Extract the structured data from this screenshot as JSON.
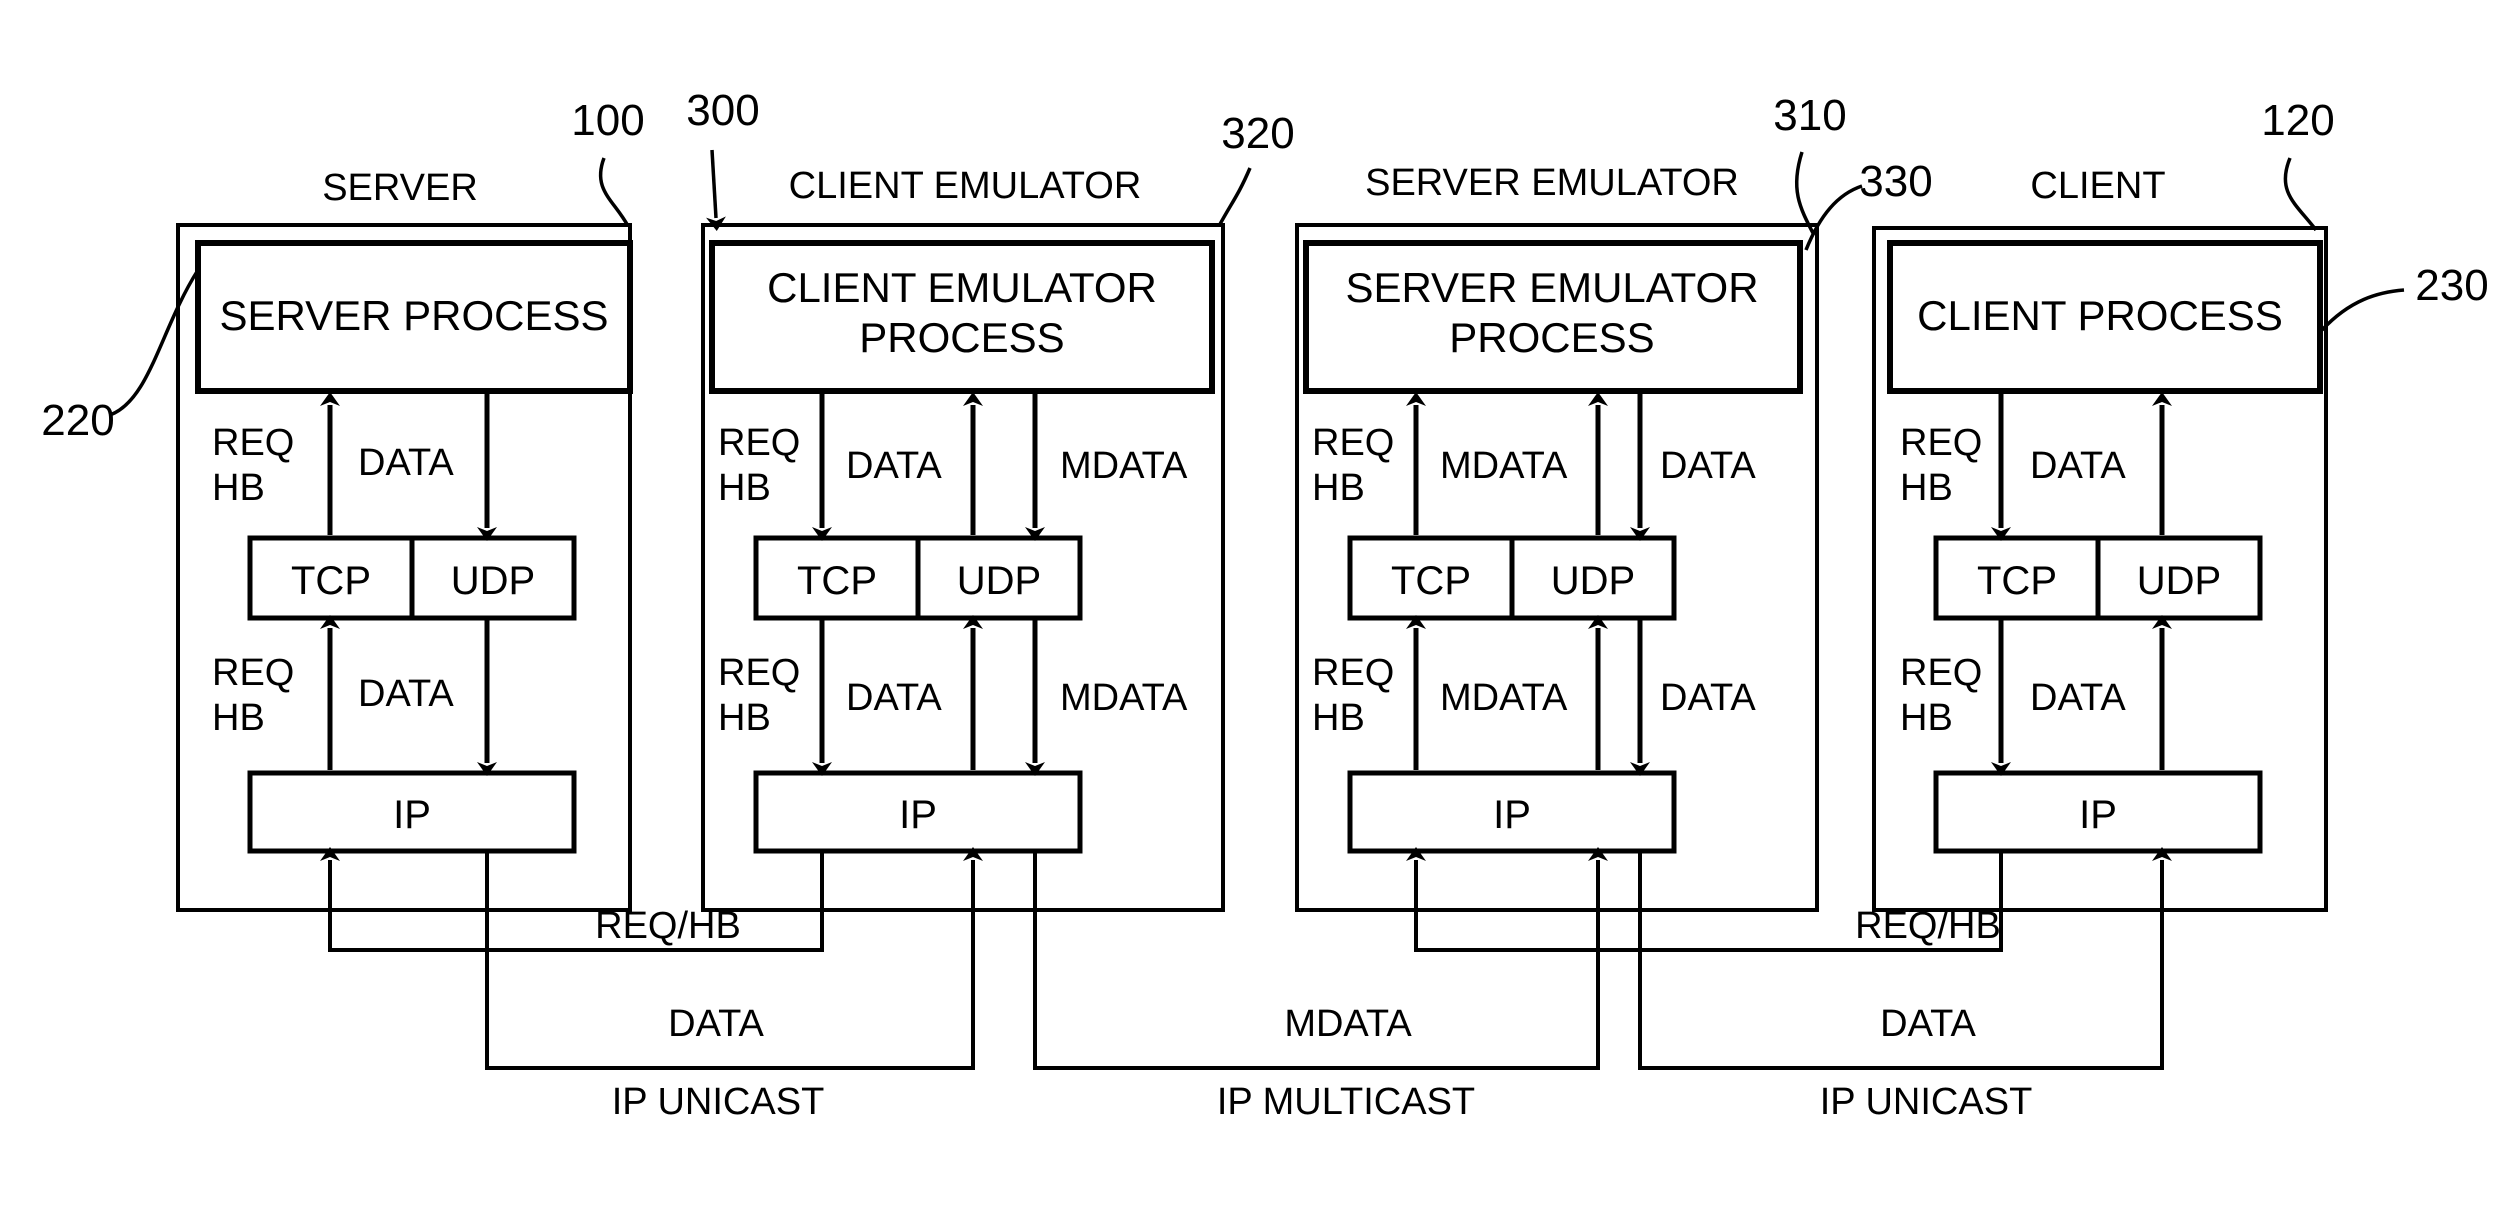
{
  "figure": {
    "title": "Client/Server emulator network stack block diagram",
    "line_color": "#000000",
    "background": "#ffffff"
  },
  "reference_numerals": [
    {
      "id": "ref-100",
      "value": "100",
      "points_to": "server-outer-box"
    },
    {
      "id": "ref-220",
      "value": "220",
      "points_to": "server-process-box"
    },
    {
      "id": "ref-300",
      "value": "300",
      "points_to": "client-emulator-outer-box"
    },
    {
      "id": "ref-320",
      "value": "320",
      "points_to": "client-emulator-process-box"
    },
    {
      "id": "ref-310",
      "value": "310",
      "points_to": "server-emulator-outer-box"
    },
    {
      "id": "ref-330",
      "value": "330",
      "points_to": "server-emulator-process-box"
    },
    {
      "id": "ref-120",
      "value": "120",
      "points_to": "client-outer-box"
    },
    {
      "id": "ref-230",
      "value": "230",
      "points_to": "client-process-box"
    }
  ],
  "panels": [
    {
      "key": "server",
      "title": "SERVER",
      "process_label": "SERVER PROCESS",
      "process_label_lines": [
        "SERVER PROCESS"
      ],
      "transport": {
        "left": "TCP",
        "right": "UDP"
      },
      "network_layer": "IP",
      "upper_flows": [
        {
          "label_lines": [
            "REQ",
            "HB"
          ],
          "column": "tcp",
          "direction": "up"
        },
        {
          "label_lines": [
            "DATA"
          ],
          "column": "udp",
          "direction": "down"
        }
      ],
      "lower_flows": [
        {
          "label_lines": [
            "REQ",
            "HB"
          ],
          "column": "tcp",
          "direction": "up"
        },
        {
          "label_lines": [
            "DATA"
          ],
          "column": "udp",
          "direction": "down"
        }
      ]
    },
    {
      "key": "client-emulator",
      "title": "CLIENT EMULATOR",
      "process_label": "CLIENT EMULATOR PROCESS",
      "process_label_lines": [
        "CLIENT EMULATOR",
        "PROCESS"
      ],
      "transport": {
        "left": "TCP",
        "right": "UDP"
      },
      "network_layer": "IP",
      "upper_flows": [
        {
          "label_lines": [
            "REQ",
            "HB"
          ],
          "column": "tcp",
          "direction": "down"
        },
        {
          "label_lines": [
            "DATA"
          ],
          "column": "udp-left",
          "direction": "up"
        },
        {
          "label_lines": [
            "MDATA"
          ],
          "column": "udp-right",
          "direction": "down"
        }
      ],
      "lower_flows": [
        {
          "label_lines": [
            "REQ",
            "HB"
          ],
          "column": "tcp",
          "direction": "down"
        },
        {
          "label_lines": [
            "DATA"
          ],
          "column": "udp-left",
          "direction": "up"
        },
        {
          "label_lines": [
            "MDATA"
          ],
          "column": "udp-right",
          "direction": "down"
        }
      ]
    },
    {
      "key": "server-emulator",
      "title": "SERVER EMULATOR",
      "process_label": "SERVER EMULATOR PROCESS",
      "process_label_lines": [
        "SERVER EMULATOR",
        "PROCESS"
      ],
      "transport": {
        "left": "TCP",
        "right": "UDP"
      },
      "network_layer": "IP",
      "upper_flows": [
        {
          "label_lines": [
            "REQ",
            "HB"
          ],
          "column": "tcp",
          "direction": "up"
        },
        {
          "label_lines": [
            "MDATA"
          ],
          "column": "udp-left",
          "direction": "up"
        },
        {
          "label_lines": [
            "DATA"
          ],
          "column": "udp-right",
          "direction": "down"
        }
      ],
      "lower_flows": [
        {
          "label_lines": [
            "REQ",
            "HB"
          ],
          "column": "tcp",
          "direction": "up"
        },
        {
          "label_lines": [
            "MDATA"
          ],
          "column": "udp-left",
          "direction": "up"
        },
        {
          "label_lines": [
            "DATA"
          ],
          "column": "udp-right",
          "direction": "down"
        }
      ]
    },
    {
      "key": "client",
      "title": "CLIENT",
      "process_label": "CLIENT PROCESS",
      "process_label_lines": [
        "CLIENT PROCESS"
      ],
      "transport": {
        "left": "TCP",
        "right": "UDP"
      },
      "network_layer": "IP",
      "upper_flows": [
        {
          "label_lines": [
            "REQ",
            "HB"
          ],
          "column": "tcp",
          "direction": "down"
        },
        {
          "label_lines": [
            "DATA"
          ],
          "column": "udp",
          "direction": "up"
        }
      ],
      "lower_flows": [
        {
          "label_lines": [
            "REQ",
            "HB"
          ],
          "column": "tcp",
          "direction": "down"
        },
        {
          "label_lines": [
            "DATA"
          ],
          "column": "udp",
          "direction": "up"
        }
      ]
    }
  ],
  "network_links": [
    {
      "key": "left-reqhb",
      "label": "REQ/HB",
      "between": [
        "server",
        "client-emulator"
      ]
    },
    {
      "key": "left-data",
      "label": "DATA",
      "between": [
        "server",
        "client-emulator"
      ]
    },
    {
      "key": "left-bus",
      "label": "IP UNICAST",
      "between": [
        "server",
        "client-emulator"
      ]
    },
    {
      "key": "mid-mdata",
      "label": "MDATA",
      "between": [
        "client-emulator",
        "server-emulator"
      ]
    },
    {
      "key": "mid-bus",
      "label": "IP MULTICAST",
      "between": [
        "client-emulator",
        "server-emulator"
      ]
    },
    {
      "key": "right-reqhb",
      "label": "REQ/HB",
      "between": [
        "server-emulator",
        "client"
      ]
    },
    {
      "key": "right-data",
      "label": "DATA",
      "between": [
        "server-emulator",
        "client"
      ]
    },
    {
      "key": "right-bus",
      "label": "IP UNICAST",
      "between": [
        "server-emulator",
        "client"
      ]
    }
  ]
}
